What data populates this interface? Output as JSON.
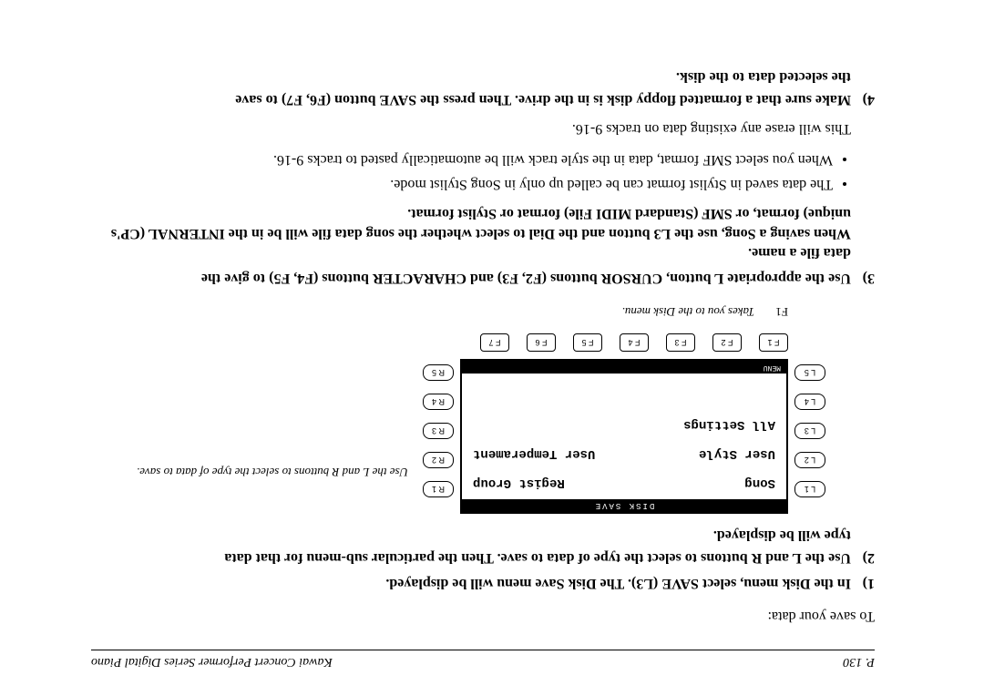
{
  "header": {
    "page": "P. 130",
    "title": "Kawai Concert Performer Series Digital Piano"
  },
  "lead": "To save your data:",
  "steps": {
    "s1": {
      "num": "1)",
      "text": "In the Disk menu, select SAVE (L3). The Disk Save menu will be displayed."
    },
    "s2": {
      "num": "2)",
      "text": "Use the L and R buttons to select the type of data to save. Then the particular sub-menu for that data",
      "extra": "type will be displayed."
    },
    "s3": {
      "num": "3)",
      "text": "Use the appropriate L button, CURSOR buttons (F2, F3) and CHARACTER buttons (F4, F5) to give the",
      "extra1": "data file a name.",
      "extra2": "When saving a Song, use the L3 button and the Dial to select whether the song data file will be in the INTERNAL (CP's unique) format, or SMF (Standard MIDI File) format or Stylist format."
    },
    "s4": {
      "num": "4)",
      "text": "Make sure that a formatted floppy disk is in the drive. Then press the SAVE button (F6, F7) to save",
      "extra": "the selected data to the disk."
    }
  },
  "screen": {
    "title": "DISK SAVE",
    "song": "Song",
    "regist": "Regist Group",
    "ustyle": "User Style",
    "utemp": "User Temperament",
    "allset": "All Settings",
    "menu": "MENU"
  },
  "L": [
    "L 1",
    "L 2",
    "L 3",
    "L 4",
    "L 5"
  ],
  "R": [
    "R 1",
    "R 2",
    "R 3",
    "R 4",
    "R 5"
  ],
  "F": [
    "F 1",
    "F 2",
    "F 3",
    "F 4",
    "F 5",
    "F 6",
    "F 7"
  ],
  "anno": {
    "right": "Use the L and R buttons to select the type of data to save.",
    "f1_label": "F1",
    "f1_text": "Takes you to the Disk menu."
  },
  "bullets": {
    "b1": "The data saved in Stylist format can be called up only in Song Stylist mode.",
    "b2": "When you select SMF format, data in the style track will be automatically pasted to tracks 9-16."
  },
  "sub": "This will erase any existing data on tracks 9-16."
}
